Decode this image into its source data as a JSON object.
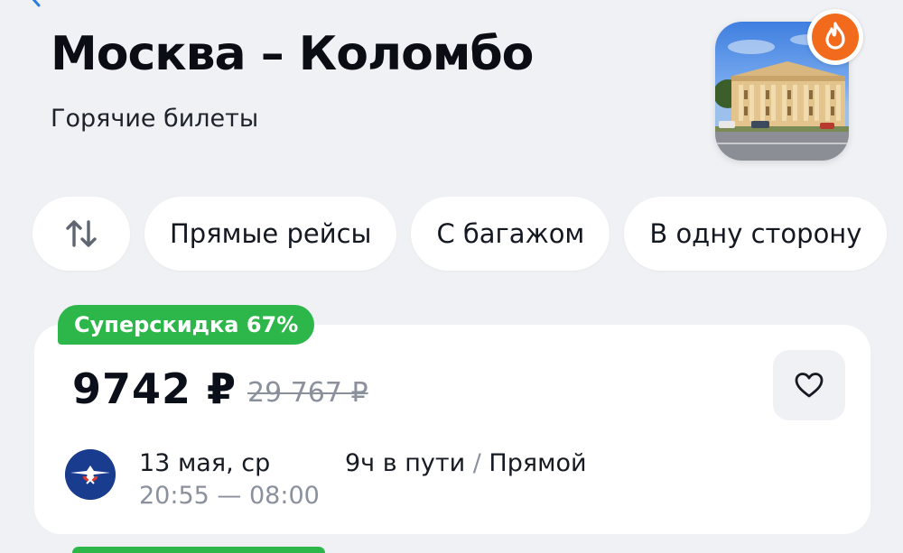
{
  "header": {
    "title": "Москва – Коломбо",
    "subtitle": "Горячие билеты"
  },
  "icons": {
    "back": "chevron-left-icon",
    "fire": "fire-icon",
    "sort": "sort-arrows-icon",
    "favorite": "heart-icon",
    "airline": "aeroflot-logo"
  },
  "filters": [
    {
      "label": "Прямые рейсы"
    },
    {
      "label": "С багажом"
    },
    {
      "label": "В одну сторону"
    }
  ],
  "ticket": {
    "badge": "Суперскидка 67%",
    "price": "9742 ₽",
    "old_price": "29 767 ₽",
    "date": "13 мая, ср",
    "departure": "20:55",
    "arrival": "08:00",
    "duration": "9ч в пути",
    "separator": "/",
    "route_type": "Прямой"
  },
  "colors": {
    "background": "#eff1f4",
    "discount_green": "#2db74a",
    "fire_orange": "#f26a1b",
    "muted_text": "#8a919d",
    "airline_blue": "#1a3c8f"
  }
}
